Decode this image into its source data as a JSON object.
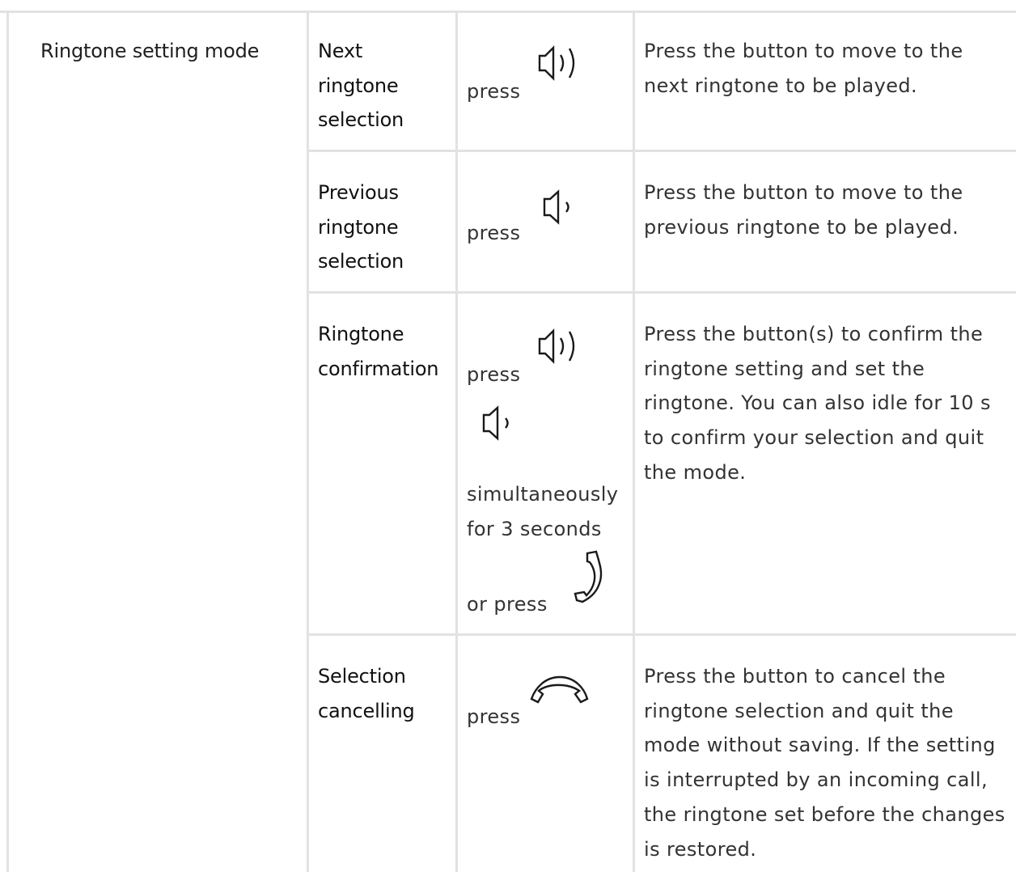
{
  "mode": {
    "label": "Ringtone setting mode"
  },
  "rows": [
    {
      "action": [
        "Next",
        "ringtone",
        "selection"
      ],
      "press": "press",
      "icon": "volume-up-icon",
      "description": "Press the button to move to the next ringtone to be played."
    },
    {
      "action": [
        "Previous",
        "ringtone",
        "selection"
      ],
      "press": "press",
      "icon": "volume-down-icon",
      "description": "Press the button to move to the previous ringtone to be played."
    },
    {
      "action": [
        "Ringtone",
        "confirmation"
      ],
      "press": "press",
      "icons": [
        "volume-up-icon",
        "volume-down-icon",
        "phone-handset-icon"
      ],
      "simultaneous": "simultaneously",
      "duration": "for 3 seconds",
      "alternative": "or press",
      "description": "Press the button(s) to confirm the ringtone setting and set the ringtone. You can also idle for 10 s to confirm your selection and quit the mode."
    },
    {
      "action": [
        "Selection",
        "cancelling"
      ],
      "press": "press",
      "icon": "hang-up-icon",
      "description": "Press the button to cancel the ringtone selection and quit the mode without saving. If the setting is interrupted by an incoming call, the ringtone set before the changes is restored."
    }
  ],
  "colors": {
    "border": "#e2e2e2",
    "text": "#1f1f1f"
  }
}
